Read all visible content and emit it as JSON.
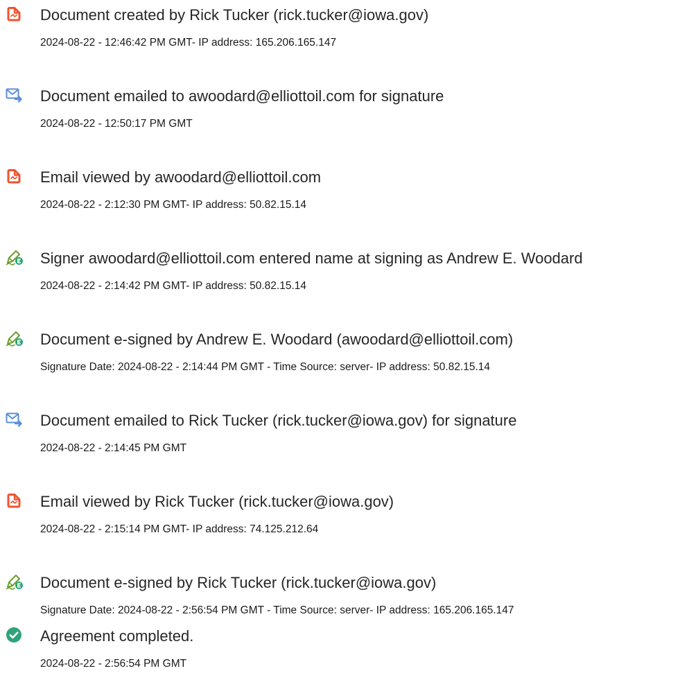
{
  "colors": {
    "document_icon": "#F0522F",
    "email_icon": "#5A8ED6",
    "esign_icon": "#6B9E2F",
    "esign_badge": "#2FA37A",
    "complete_icon": "#2FA37A"
  },
  "events": [
    {
      "icon": "document-icon",
      "title": "Document created by Rick Tucker (rick.tucker@iowa.gov)",
      "detail": "2024-08-22 - 12:46:42 PM GMT- IP address: 165.206.165.147"
    },
    {
      "icon": "email-sent-icon",
      "title": "Document emailed to awoodard@elliottoil.com for signature",
      "detail": "2024-08-22 - 12:50:17 PM GMT"
    },
    {
      "icon": "document-icon",
      "title": "Email viewed by awoodard@elliottoil.com",
      "detail": "2024-08-22 - 2:12:30 PM GMT- IP address: 50.82.15.14"
    },
    {
      "icon": "esign-pen-icon",
      "title": "Signer awoodard@elliottoil.com entered name at signing as Andrew E. Woodard",
      "detail": "2024-08-22 - 2:14:42 PM GMT- IP address: 50.82.15.14"
    },
    {
      "icon": "esign-pen-icon",
      "title": "Document e-signed by Andrew E. Woodard (awoodard@elliottoil.com)",
      "detail": "Signature Date: 2024-08-22 - 2:14:44 PM GMT - Time Source: server- IP address: 50.82.15.14"
    },
    {
      "icon": "email-sent-icon",
      "title": "Document emailed to Rick Tucker (rick.tucker@iowa.gov) for signature",
      "detail": "2024-08-22 - 2:14:45 PM GMT"
    },
    {
      "icon": "document-icon",
      "title": "Email viewed by Rick Tucker (rick.tucker@iowa.gov)",
      "detail": "2024-08-22 - 2:15:14 PM GMT- IP address: 74.125.212.64"
    },
    {
      "icon": "esign-pen-icon",
      "title": "Document e-signed by Rick Tucker (rick.tucker@iowa.gov)",
      "detail": "Signature Date: 2024-08-22 - 2:56:54 PM GMT - Time Source: server- IP address: 165.206.165.147"
    },
    {
      "icon": "checkmark-circle-icon",
      "title": "Agreement completed.",
      "detail": "2024-08-22 - 2:56:54 PM GMT"
    }
  ]
}
